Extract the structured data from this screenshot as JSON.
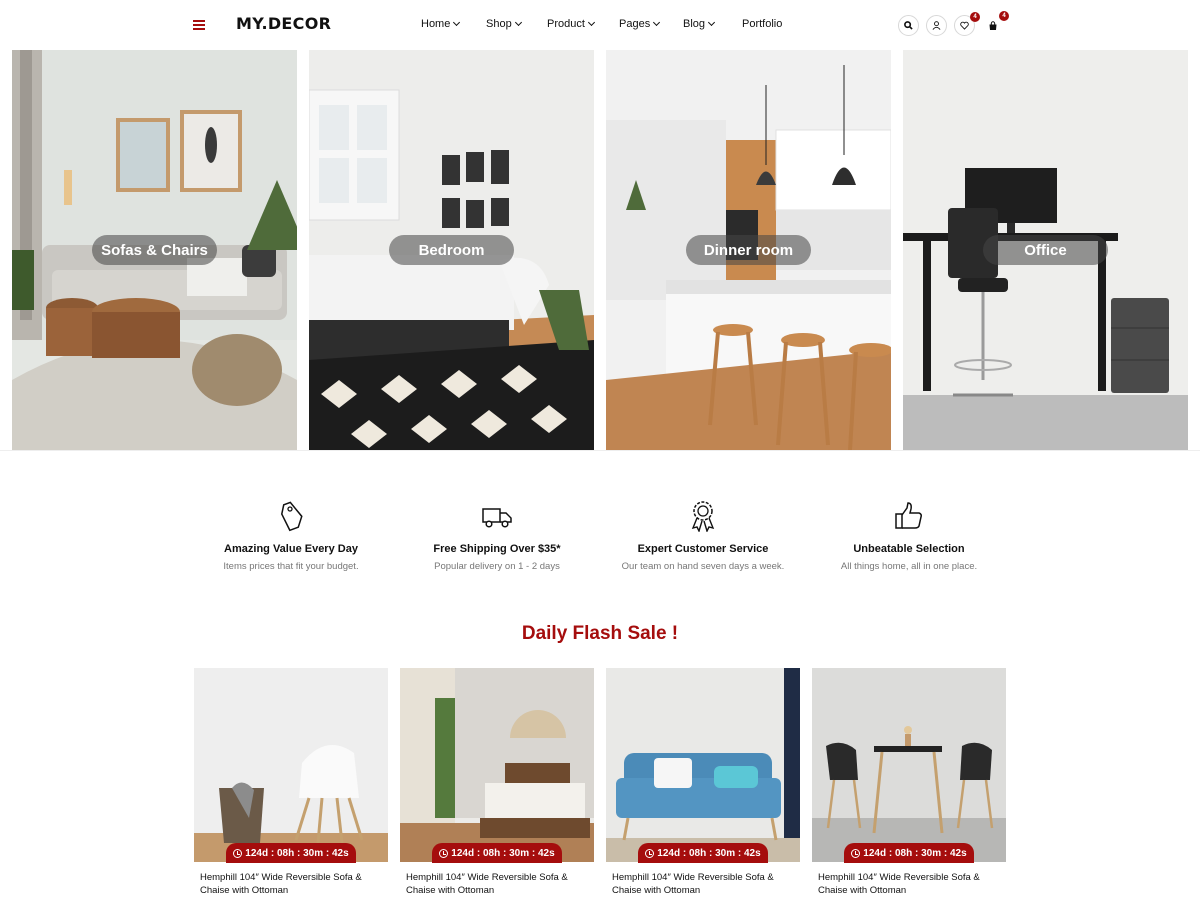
{
  "header": {
    "logo": "MY.DECOR",
    "nav": [
      {
        "label": "Home",
        "has_dropdown": true
      },
      {
        "label": "Shop",
        "has_dropdown": true
      },
      {
        "label": "Product",
        "has_dropdown": true
      },
      {
        "label": "Pages",
        "has_dropdown": true
      },
      {
        "label": "Blog",
        "has_dropdown": true
      },
      {
        "label": "Portfolio",
        "has_dropdown": false
      }
    ],
    "icons": [
      "search-icon",
      "user-icon",
      "heart-icon",
      "cart-icon"
    ],
    "wishlist_count": "4",
    "cart_count": "4"
  },
  "categories": [
    {
      "label": "Sofas & Chairs",
      "image": "living-room"
    },
    {
      "label": "Bedroom",
      "image": "bedroom"
    },
    {
      "label": "Dinner room",
      "image": "kitchen"
    },
    {
      "label": "Office",
      "image": "office"
    }
  ],
  "features": [
    {
      "icon": "price-tag-icon",
      "title": "Amazing Value Every Day",
      "desc": "Items prices that fit your budget."
    },
    {
      "icon": "delivery-truck-icon",
      "title": "Free Shipping Over $35*",
      "desc": "Popular delivery on 1 - 2 days"
    },
    {
      "icon": "award-ribbon-icon",
      "title": "Expert Customer Service",
      "desc": "Our team on hand seven days a week."
    },
    {
      "icon": "thumbs-up-icon",
      "title": "Unbeatable Selection",
      "desc": "All things home, all in one place."
    }
  ],
  "flash_sale": {
    "title": "Daily Flash Sale !",
    "products": [
      {
        "name": "Hemphill 104″ Wide Reversible Sofa & Chaise with Ottoman",
        "countdown": "124d : 08h : 30m : 42s"
      },
      {
        "name": "Hemphill 104″ Wide Reversible Sofa & Chaise with Ottoman",
        "countdown": "124d : 08h : 30m : 42s"
      },
      {
        "name": "Hemphill 104″ Wide Reversible Sofa & Chaise with Ottoman",
        "countdown": "124d : 08h : 30m : 42s"
      },
      {
        "name": "Hemphill 104″ Wide Reversible Sofa & Chaise with Ottoman",
        "countdown": "124d : 08h : 30m : 42s"
      }
    ]
  },
  "colors": {
    "accent": "#a50d0d",
    "text": "#111111",
    "muted": "#777777"
  }
}
